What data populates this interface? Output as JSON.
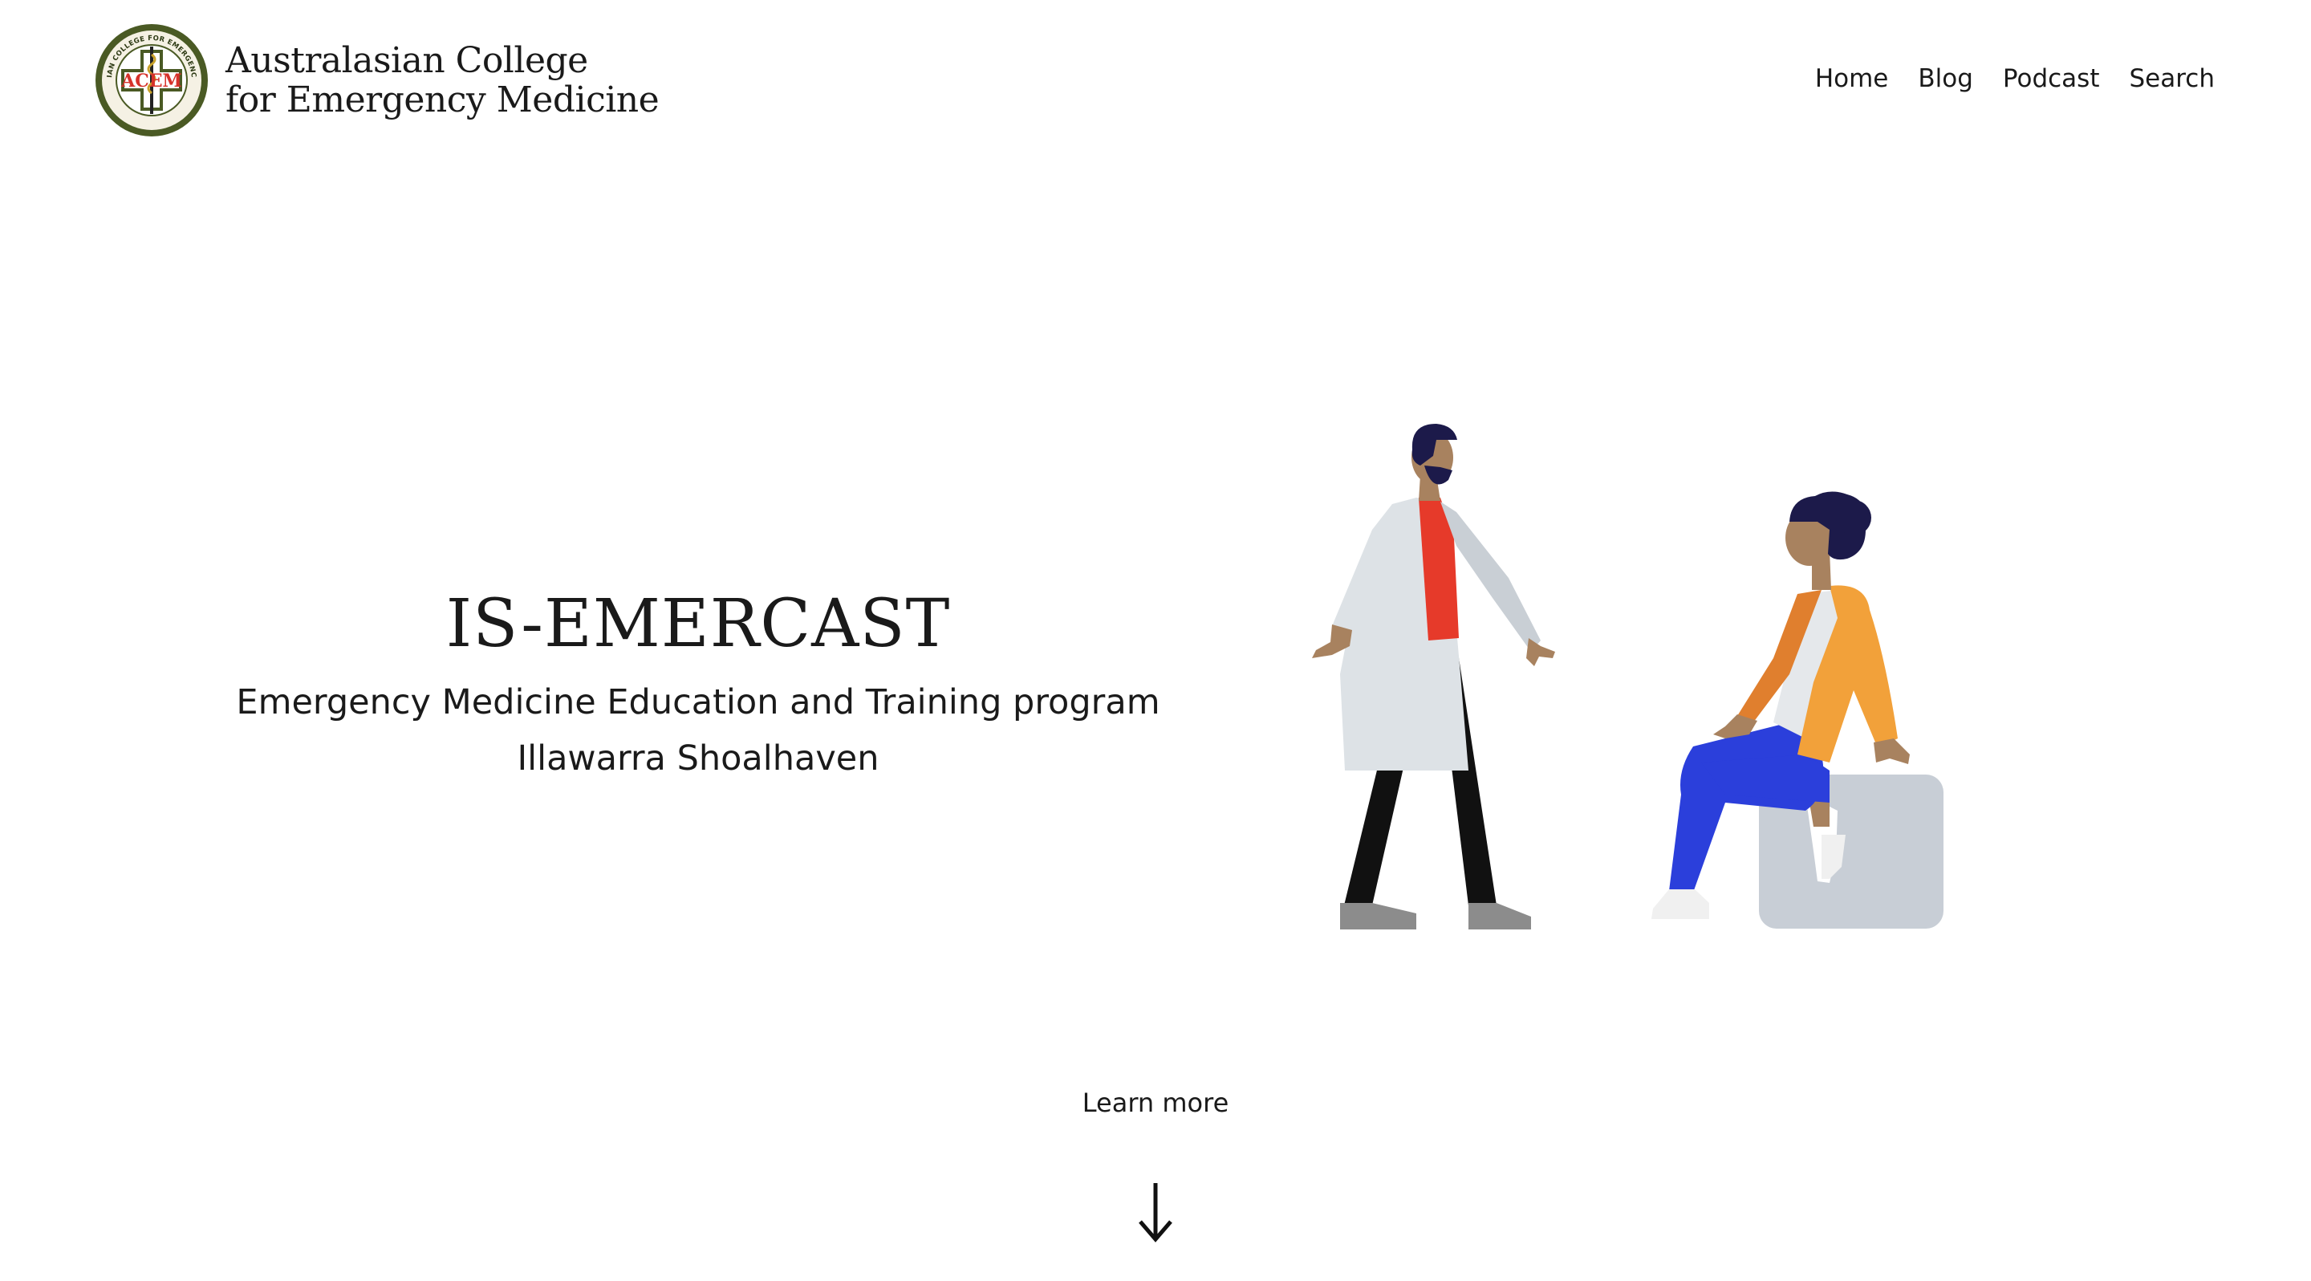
{
  "header": {
    "logo_icon": "acem-seal-icon",
    "logo_text": "ACEM",
    "seal_text": "AUSTRALASIAN COLLEGE FOR EMERGENCY MEDICINE",
    "title_line1": "Australasian College",
    "title_line2": "for Emergency Medicine"
  },
  "nav": {
    "items": [
      {
        "label": "Home"
      },
      {
        "label": "Blog"
      },
      {
        "label": "Podcast"
      },
      {
        "label": "Search"
      }
    ]
  },
  "hero": {
    "title": "IS-EMERCAST",
    "subtitle_line1": "Emergency Medicine Education and Training program",
    "subtitle_line2": "Illawarra Shoalhaven",
    "illustration": "doctor-and-patient-illustration"
  },
  "footer_cta": {
    "label": "Learn more",
    "icon": "arrow-down-icon"
  },
  "colors": {
    "background": "#ffffff",
    "text": "#1a1a1a",
    "logo_green": "#4a5a24",
    "logo_red": "#d6322a",
    "coat": "#dde2e6",
    "shirt_red": "#e63a2a",
    "jacket_orange": "#f2a13a",
    "pants_blue": "#2b3fdb",
    "stool": "#c8ced6",
    "hair": "#1c1a4a",
    "skin": "#a8825f"
  }
}
